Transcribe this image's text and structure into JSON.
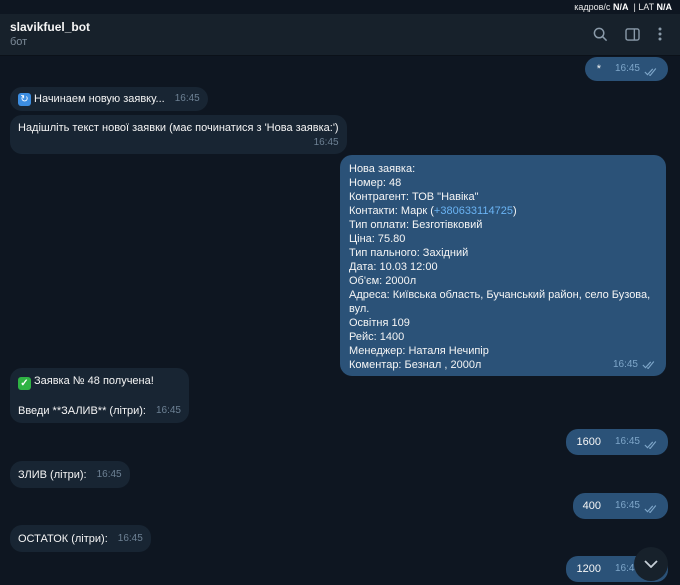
{
  "overlay": {
    "fps_label": "кадров/с",
    "fps_value": "N/A",
    "lat_label": "LAT",
    "lat_value": "N/A"
  },
  "header": {
    "title": "slavikfuel_bot",
    "subtitle": "бот"
  },
  "messages": {
    "m0": {
      "text": "*",
      "time": "16:45"
    },
    "m1": {
      "text": "Начинаем новую заявку...",
      "time": "16:45"
    },
    "m2": {
      "text": "Надішліть текст нової заявки (має починатися з 'Нова заявка:')",
      "time": "16:45"
    },
    "m3": {
      "l1": "Нова заявка:",
      "l2": "Номер: 48",
      "l3": "Контрагент: ТОВ \"Навіка\"",
      "l4_prefix": "Контакти: Марк (",
      "l4_phone": "+380633114725",
      "l4_suffix": ")",
      "l5": "Тип оплати: Безготівковий",
      "l6": "Ціна: 75.80",
      "l7": "Тип пального: Західний",
      "l8": "Дата: 10.03 12:00",
      "l9": "Об'єм: 2000л",
      "l10": "Адреса: Київська область, Бучанський район, село Бузова, вул.",
      "l11": "Освітня 109",
      "l12": "Рейс: 1400",
      "l13": "Менеджер: Наталя Нечипір",
      "l14": "Коментар: Безнал , 2000л",
      "time": "16:45"
    },
    "m4": {
      "l1": "Заявка № 48 получена!",
      "l2": "Введи **ЗАЛИВ** (літри):",
      "time": "16:45"
    },
    "m5": {
      "text": "1600",
      "time": "16:45"
    },
    "m6": {
      "text": "ЗЛИВ (літри):",
      "time": "16:45"
    },
    "m7": {
      "text": "400",
      "time": "16:45"
    },
    "m8": {
      "text": "ОСТАТОК (літри):",
      "time": "16:45"
    },
    "m9": {
      "text": "1200",
      "time": "16:45"
    }
  }
}
